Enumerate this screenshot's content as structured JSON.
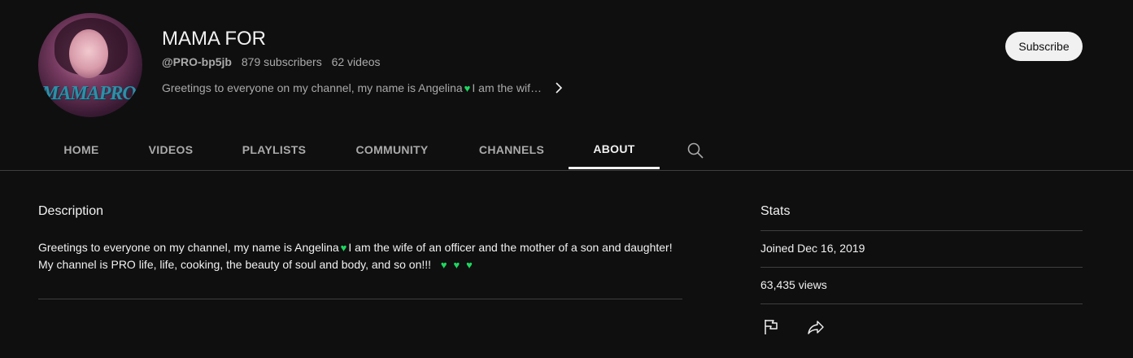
{
  "channel": {
    "name": "MAMA FOR",
    "handle": "@PRO-bp5jb",
    "subscribers": "879 subscribers",
    "videos": "62 videos",
    "teaser": "Greetings to everyone on my channel, my name is Angelina",
    "teaser_tail": "I am the wif…",
    "avatar_text": "MAMAPRO",
    "subscribe_label": "Subscribe"
  },
  "tabs": [
    {
      "label": "HOME"
    },
    {
      "label": "VIDEOS"
    },
    {
      "label": "PLAYLISTS"
    },
    {
      "label": "COMMUNITY"
    },
    {
      "label": "CHANNELS"
    },
    {
      "label": "ABOUT",
      "active": true
    }
  ],
  "about": {
    "description_title": "Description",
    "description_line1_a": "Greetings to everyone on my channel, my name is Angelina",
    "description_line1_b": "I am the wife of an officer and the mother of a son and daughter!",
    "description_line2": "My channel is PRO life, life, cooking, the beauty of soul and body, and so on!!!",
    "stats_title": "Stats",
    "joined": "Joined Dec 16, 2019",
    "views": "63,435 views"
  },
  "icons": {
    "heart": "green-heart-icon",
    "search": "search-icon",
    "chevron": "chevron-right-icon",
    "flag": "flag-icon",
    "share": "share-icon"
  },
  "colors": {
    "background": "#0f0f0f",
    "text": "#f1f1f1",
    "secondary_text": "#aaaaaa",
    "heart": "#1ed760",
    "subscribe_bg": "#f1f1f1"
  }
}
